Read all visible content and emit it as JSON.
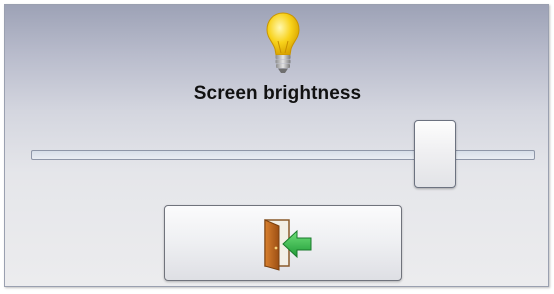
{
  "title": "Screen brightness",
  "brightness": {
    "min": 0,
    "max": 100,
    "value": 83
  },
  "icons": {
    "header": "lightbulb-icon",
    "exit_button": "exit-door-icon"
  },
  "colors": {
    "bulb": "#f5c400",
    "door": "#b8651e",
    "arrow": "#2fb34a"
  }
}
